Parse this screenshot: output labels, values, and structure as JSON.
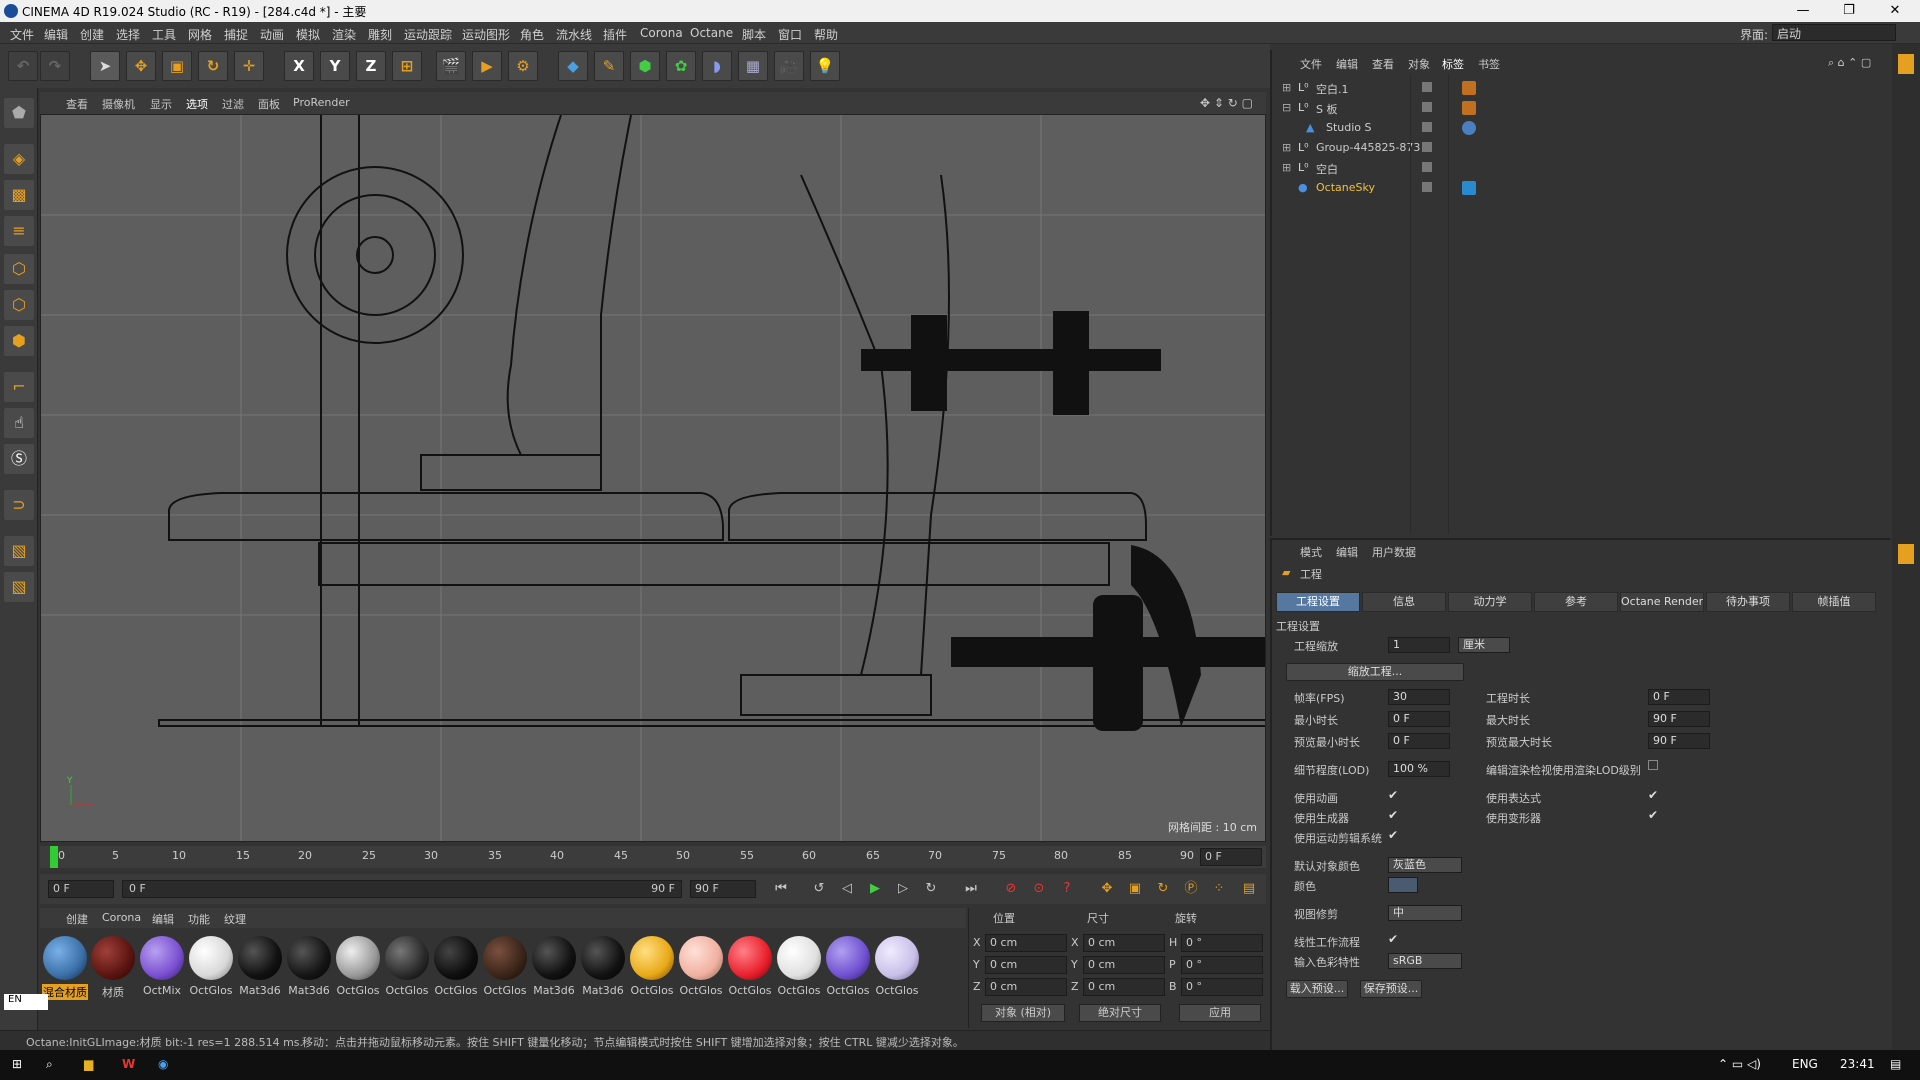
{
  "titlebar": {
    "title": "CINEMA 4D R19.024 Studio (RC - R19) - [284.c4d *] - 主要",
    "min": "—",
    "max": "❐",
    "close": "✕"
  },
  "menubar": {
    "items": [
      "文件",
      "编辑",
      "创建",
      "选择",
      "工具",
      "网格",
      "捕捉",
      "动画",
      "模拟",
      "渲染",
      "雕刻",
      "运动跟踪",
      "运动图形",
      "角色",
      "流水线",
      "插件",
      "Corona",
      "Octane",
      "脚本",
      "窗口",
      "帮助"
    ],
    "layout_label": "界面:",
    "layout_value": "启动"
  },
  "toolbar": {
    "axis_x": "X",
    "axis_y": "Y",
    "axis_z": "Z"
  },
  "viewport": {
    "menu": [
      "查看",
      "摄像机",
      "显示",
      "选项",
      "过滤",
      "面板",
      "ProRender"
    ],
    "grid_label": "网格间距 : 10 cm"
  },
  "timeline": {
    "ticks": [
      "0",
      "5",
      "10",
      "15",
      "20",
      "25",
      "30",
      "35",
      "40",
      "45",
      "50",
      "55",
      "60",
      "65",
      "70",
      "75",
      "80",
      "85",
      "90"
    ],
    "end_frame": "0 F"
  },
  "playbar": {
    "start_field": "0 F",
    "range_start": "0 F",
    "range_end": "90 F",
    "end_field": "90 F"
  },
  "materials": {
    "menu": [
      "创建",
      "Corona",
      "编辑",
      "功能",
      "纹理"
    ],
    "items": [
      {
        "label": "混合材质",
        "color": "#3a6fa8"
      },
      {
        "label": "材质",
        "color": "#5a1410"
      },
      {
        "label": "OctMix",
        "color": "#7a4fd0"
      },
      {
        "label": "OctGlos",
        "color": "#e6e6e6"
      },
      {
        "label": "Mat3d6",
        "color": "#111111"
      },
      {
        "label": "Mat3d6",
        "color": "#151515"
      },
      {
        "label": "OctGlos",
        "color": "#bdbdbd"
      },
      {
        "label": "OctGlos",
        "color": "#2a2a2a"
      },
      {
        "label": "OctGlos",
        "color": "#0e0e0e"
      },
      {
        "label": "OctGlos",
        "color": "#3a2418"
      },
      {
        "label": "Mat3d6",
        "color": "#111111"
      },
      {
        "label": "Mat3d6",
        "color": "#121212"
      },
      {
        "label": "OctGlos",
        "color": "#e8a818"
      },
      {
        "label": "OctGlos",
        "color": "#f0b0a0"
      },
      {
        "label": "OctGlos",
        "color": "#e8202c"
      },
      {
        "label": "OctGlos",
        "color": "#eeeeee"
      },
      {
        "label": "OctGlos",
        "color": "#7050d0"
      },
      {
        "label": "OctGlos",
        "color": "#c8c0e8"
      }
    ]
  },
  "coords": {
    "headers": [
      "位置",
      "尺寸",
      "旋转"
    ],
    "rows": [
      {
        "a": "X",
        "pos": "0 cm",
        "b": "X",
        "size": "0 cm",
        "c": "H",
        "rot": "0 °"
      },
      {
        "a": "Y",
        "pos": "0 cm",
        "b": "Y",
        "size": "0 cm",
        "c": "P",
        "rot": "0 °"
      },
      {
        "a": "Z",
        "pos": "0 cm",
        "b": "Z",
        "size": "0 cm",
        "c": "B",
        "rot": "0 °"
      }
    ],
    "mode": "对象 (相对)",
    "size_mode": "绝对尺寸",
    "apply": "应用"
  },
  "statusbar": {
    "left": "Octane:InitGLImage:材质  bit:-1 res=1  288.514 ms.",
    "hint": "移动：点击并拖动鼠标移动元素。按住 SHIFT 键量化移动；节点编辑模式时按住 SHIFT 键增加选择对象；按住 CTRL 键减少选择对象。"
  },
  "objects": {
    "menu": [
      "文件",
      "编辑",
      "查看",
      "对象",
      "标签",
      "书签"
    ],
    "rows": [
      {
        "name": "空白.1",
        "tag": "#c07020"
      },
      {
        "name": "S 板",
        "tag": "#c07020"
      },
      {
        "name": "Studio S",
        "tag": "#4a7fc0"
      },
      {
        "name": "Group-445825-873",
        "tag": ""
      },
      {
        "name": "空白",
        "tag": ""
      },
      {
        "name": "OctaneSky",
        "tag": "#2a8ad0"
      }
    ]
  },
  "attributes": {
    "menu": [
      "模式",
      "编辑",
      "用户数据"
    ],
    "section_title": "工程",
    "tabs": [
      "工程设置",
      "信息",
      "动力学",
      "参考",
      "Octane Render",
      "待办事项",
      "帧插值"
    ],
    "group": "工程设置",
    "scale_label": "工程缩放",
    "scale_value": "1",
    "scale_unit": "厘米",
    "scale_btn": "缩放工程...",
    "fps_label": "帧率(FPS)",
    "fps_value": "30",
    "duration_label": "工程时长",
    "duration_value": "0 F",
    "min_label": "最小时长",
    "min_value": "0 F",
    "max_label": "最大时长",
    "max_value": "90 F",
    "pmin_label": "预览最小时长",
    "pmin_value": "0 F",
    "pmax_label": "预览最大时长",
    "pmax_value": "90 F",
    "lod_label": "细节程度(LOD)",
    "lod_value": "100 %",
    "lod_check_label": "编辑渲染检视使用渲染LOD级别",
    "use_anim": "使用动画",
    "use_expr": "使用表达式",
    "use_gen": "使用生成器",
    "use_deform": "使用变形器",
    "use_mograph": "使用运动剪辑系统",
    "default_color_label": "默认对象颜色",
    "default_color_value": "灰蓝色",
    "color_label": "颜色",
    "view_clip_label": "视图修剪",
    "view_clip_value": "中",
    "linear_label": "线性工作流程",
    "input_color_label": "输入色彩特性",
    "input_color_value": "sRGB",
    "load_preset": "载入预设...",
    "save_preset": "保存预设..."
  },
  "taskbar": {
    "lang": "ENG",
    "time": "23:41",
    "ime": "EN"
  }
}
